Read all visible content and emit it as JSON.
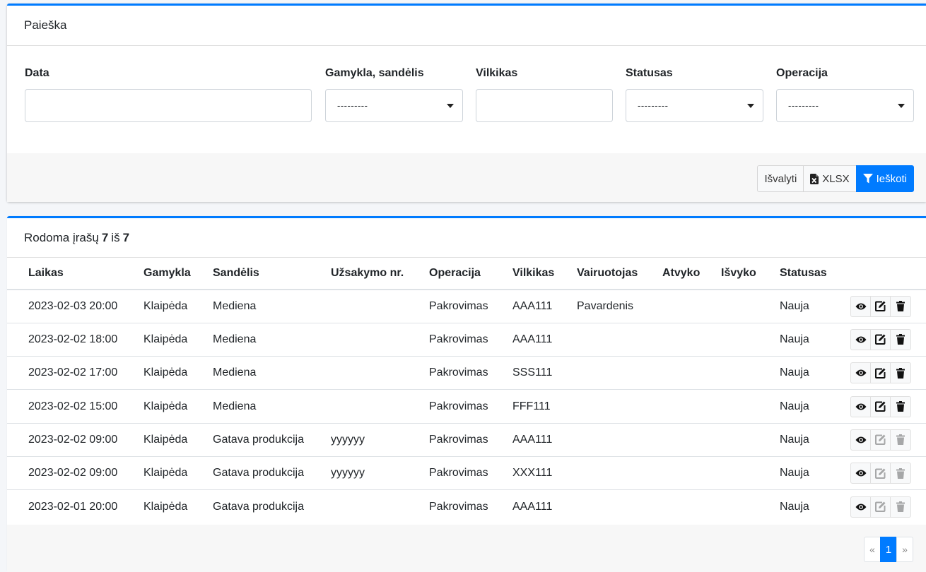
{
  "search_card": {
    "title": "Paieška",
    "filters": {
      "date_label": "Data",
      "date_value": "",
      "plant_label": "Gamykla, sandėlis",
      "plant_value": "---------",
      "truck_label": "Vilkikas",
      "truck_value": "",
      "status_label": "Statusas",
      "status_value": "---------",
      "operation_label": "Operacija",
      "operation_value": "---------"
    },
    "buttons": {
      "clear": "Išvalyti",
      "xlsx": "XLSX",
      "search": "Ieškoti"
    }
  },
  "results_card": {
    "summary_prefix": "Rodoma įrašų",
    "shown": "7",
    "summary_mid": "iš",
    "total": "7",
    "columns": [
      "Laikas",
      "Gamykla",
      "Sandėlis",
      "Užsakymo nr.",
      "Operacija",
      "Vilkikas",
      "Vairuotojas",
      "Atvyko",
      "Išvyko",
      "Statusas"
    ],
    "rows": [
      {
        "time": "2023-02-03 20:00",
        "plant": "Klaipėda",
        "warehouse": "Mediena",
        "order": "",
        "operation": "Pakrovimas",
        "truck": "AAA111",
        "driver": "Pavardenis",
        "arrived": "",
        "left": "",
        "status": "Nauja"
      },
      {
        "time": "2023-02-02 18:00",
        "plant": "Klaipėda",
        "warehouse": "Mediena",
        "order": "",
        "operation": "Pakrovimas",
        "truck": "AAA111",
        "driver": "",
        "arrived": "",
        "left": "",
        "status": "Nauja"
      },
      {
        "time": "2023-02-02 17:00",
        "plant": "Klaipėda",
        "warehouse": "Mediena",
        "order": "",
        "operation": "Pakrovimas",
        "truck": "SSS111",
        "driver": "",
        "arrived": "",
        "left": "",
        "status": "Nauja"
      },
      {
        "time": "2023-02-02 15:00",
        "plant": "Klaipėda",
        "warehouse": "Mediena",
        "order": "",
        "operation": "Pakrovimas",
        "truck": "FFF111",
        "driver": "",
        "arrived": "",
        "left": "",
        "status": "Nauja"
      },
      {
        "time": "2023-02-02 09:00",
        "plant": "Klaipėda",
        "warehouse": "Gatava produkcija",
        "order": "yyyyyy",
        "operation": "Pakrovimas",
        "truck": "AAA111",
        "driver": "",
        "arrived": "",
        "left": "",
        "status": "Nauja"
      },
      {
        "time": "2023-02-02 09:00",
        "plant": "Klaipėda",
        "warehouse": "Gatava produkcija",
        "order": "yyyyyy",
        "operation": "Pakrovimas",
        "truck": "XXX111",
        "driver": "",
        "arrived": "",
        "left": "",
        "status": "Nauja"
      },
      {
        "time": "2023-02-01 20:00",
        "plant": "Klaipėda",
        "warehouse": "Gatava produkcija",
        "order": "",
        "operation": "Pakrovimas",
        "truck": "AAA111",
        "driver": "",
        "arrived": "",
        "left": "",
        "status": "Nauja"
      }
    ],
    "pagination": {
      "prev": "«",
      "current": "1",
      "next": "»"
    }
  },
  "icons": {
    "view": "eye-icon",
    "edit": "edit-icon",
    "delete": "trash-icon",
    "xlsx": "file-excel-icon",
    "search": "filter-icon"
  },
  "colors": {
    "accent": "#007bff"
  }
}
